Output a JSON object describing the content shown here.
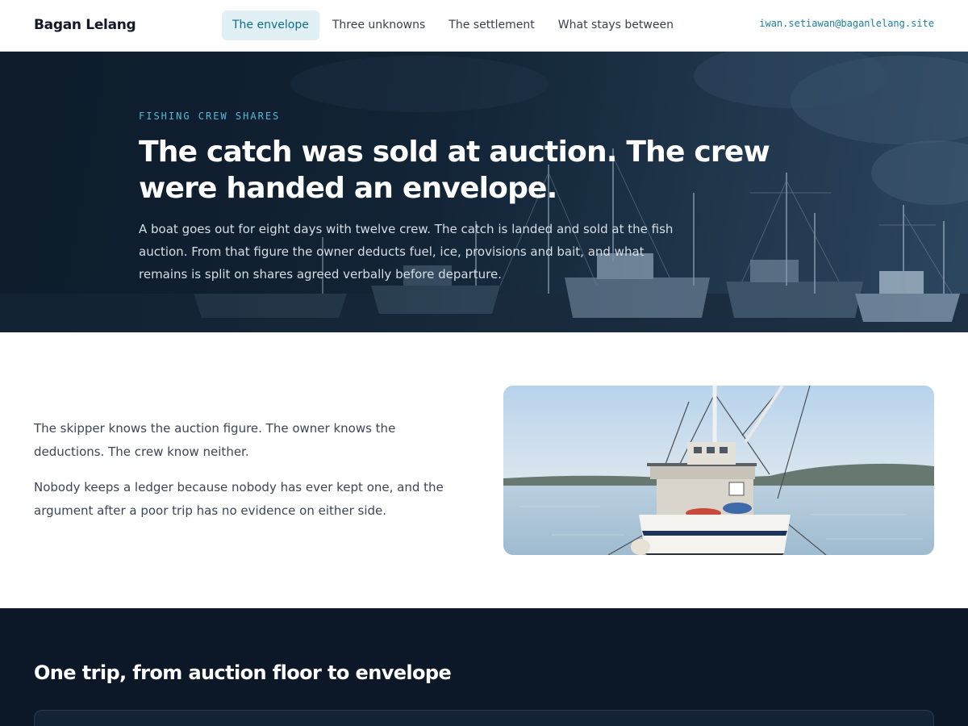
{
  "header": {
    "brand": "Bagan Lelang",
    "nav": [
      {
        "label": "The envelope",
        "active": true
      },
      {
        "label": "Three unknowns",
        "active": false
      },
      {
        "label": "The settlement",
        "active": false
      },
      {
        "label": "What stays between",
        "active": false
      }
    ],
    "account_email": "iwan.setiawan@baganlelang.site"
  },
  "hero": {
    "eyebrow": "FISHING CREW SHARES",
    "title": "The catch was sold at auction. The crew were handed an envelope.",
    "lede": "A boat goes out for eight days with twelve crew. The catch is landed and sold at the fish auction. From that figure the owner deducts fuel, ice, provisions and bait, and what remains is split on shares agreed verbally before departure."
  },
  "intro": {
    "paragraphs": [
      "The skipper knows the auction figure. The owner knows the deductions. The crew know neither.",
      "Nobody keeps a ledger because nobody has ever kept one, and the argument after a poor trip has no evidence on either side."
    ]
  },
  "trip_section": {
    "title": "One trip, from auction floor to envelope"
  },
  "colors": {
    "accent": "#1a7fa3",
    "nav_active_bg": "#e0f0f5",
    "hero_bg": "#132639",
    "dark_bg": "#0c1828"
  }
}
